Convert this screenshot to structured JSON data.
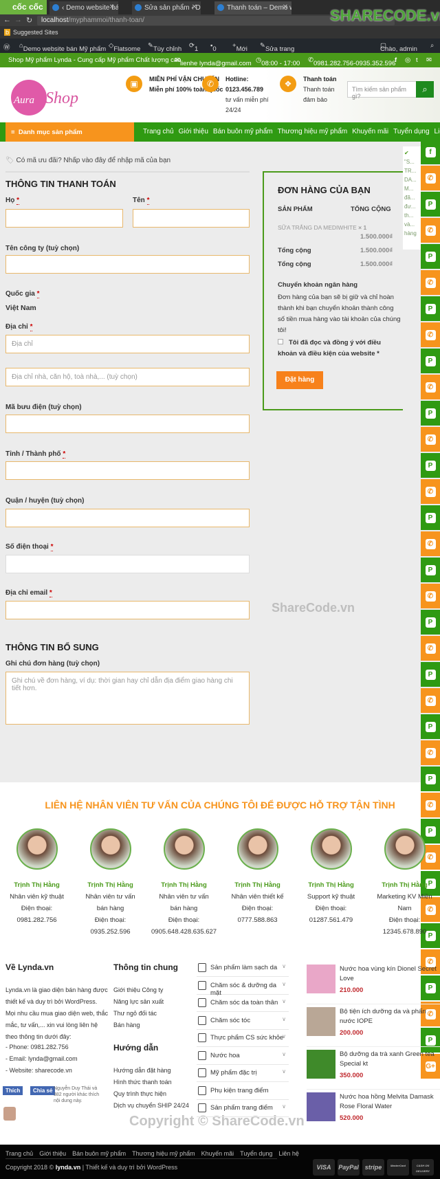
{
  "browser": {
    "brand": "cốc cốc",
    "tabs": [
      "‹ Demo website bán Mỹ p",
      "Sửa sản phẩm ‹ Demo we",
      "Thanh toán – Demo websi"
    ],
    "url_host": "localhost",
    "url_path": "/myphammoi/thanh-toan/",
    "bookmark": "Suggested Sites"
  },
  "wpbar": {
    "site": "Demo website bán Mỹ phẩm",
    "theme": "Flatsome",
    "customize": "Tùy chỉnh",
    "updates": "1",
    "comments": "0",
    "new": "Mới",
    "edit": "Sửa trang",
    "greeting": "Chào, admin"
  },
  "topbar": {
    "tagline": "Shop Mỹ phẩm Lynda - Cung cấp Mỹ phẩm Chất lượng cao",
    "email": "lienhe lynda@gmail.com",
    "hours": "08:00 - 17:00",
    "phone": "0981.282.756-0935.352.596"
  },
  "header": {
    "logo": "The Aura Shop",
    "f1_title": "MIỄN PHÍ VẬN CHUYỂN",
    "f1_text": "Miễn phí 100% toàn quốc",
    "f2_title": "Hotline:",
    "f2_phone": "0123.456.789",
    "f2_text": "tư vấn miễn phí 24/24",
    "f3_title": "Thanh toán",
    "f3_text": "Thanh toán đảm bảo",
    "search_placeholder": "Tìm kiếm sản phẩm gì?"
  },
  "nav": {
    "category": "Danh mục sản phẩm",
    "links": [
      "Trang chủ",
      "Giới thiệu",
      "Bán buôn mỹ phẩm",
      "Thương hiệu mỹ phẩm",
      "Khuyến mãi",
      "Tuyển dụng",
      "Liên hệ"
    ]
  },
  "checkout": {
    "coupon": "Có mã ưu đãi? Nhấp vào đây để nhập mã của bạn",
    "billing_title": "THÔNG TIN THANH TOÁN",
    "first_name": "Họ",
    "last_name": "Tên",
    "required": "*",
    "company": "Tên công ty (tuỳ chọn)",
    "country": "Quốc gia",
    "country_value": "Việt Nam",
    "address": "Địa chỉ",
    "address_ph": "Địa chỉ",
    "address2_ph": "Địa chỉ nhà, căn hộ, toà nhà,... (tuỳ chọn)",
    "postcode": "Mã bưu điện (tuỳ chọn)",
    "city": "Tỉnh / Thành phố",
    "district": "Quận / huyện (tuỳ chọn)",
    "phone": "Số điện thoại",
    "email": "Địa chỉ email",
    "extra_title": "THÔNG TIN BỔ SUNG",
    "notes": "Ghi chú đơn hàng (tuỳ chọn)",
    "notes_ph": "Ghi chú về đơn hàng, ví dụ: thời gian hay chỉ dẫn địa điểm giao hàng chi tiết hơn."
  },
  "order": {
    "title": "ĐƠN HÀNG CỦA BẠN",
    "col_product": "SẢN PHẨM",
    "col_total": "TỔNG CỘNG",
    "item": "SỮA TRẮNG DA MEDIWHITE",
    "qty": "× 1",
    "item_total": "1.500.000₫",
    "subtotal_label": "Tổng cộng",
    "subtotal": "1.500.000₫",
    "total_label": "Tổng cộng",
    "total": "1.500.000₫",
    "payment_title": "Chuyển khoản ngân hàng",
    "payment_desc": "Đơn hàng của bạn sẽ bị giữ và chỉ hoàn thành khi bạn chuyển khoản thành công số tiền mua hàng vào tài khoản của chúng tôi!",
    "terms": "Tôi đã đọc và đồng ý với điều khoản và điều kiện của website *",
    "place_order": "Đặt hàng"
  },
  "popup": {
    "text": "\"S... TR... DA... M... đã... đư... th... và... hàng"
  },
  "floating_buttons": {
    "first": "facebook",
    "pattern": [
      "phone",
      "pinterest"
    ],
    "last": "google-plus",
    "colors": {
      "phone": "#f7941d",
      "pinterest": "#2f9a12",
      "facebook": "#2f9a12",
      "google-plus": "#f7941d"
    }
  },
  "watermarks": {
    "logo": "SHARECODE.vn",
    "mid": "ShareCode.vn",
    "bottom": "Copyright © ShareCode.vn"
  },
  "staff": {
    "title": "LIÊN HỆ NHÂN VIÊN TƯ VẤN CỦA CHÚNG TÔI ĐỂ ĐƯỢC HỖ TRỢ TẬN TÌNH",
    "members": [
      {
        "name": "Trịnh Thị Hằng",
        "role": "Nhân viên kỹ thuật",
        "phone": "Điện thoại: 0981.282.756"
      },
      {
        "name": "Trịnh Thị Hằng",
        "role": "Nhân viên tư vấn bán hàng",
        "phone": "Điện thoại: 0935.252.596"
      },
      {
        "name": "Trịnh Thị Hằng",
        "role": "Nhân viên tư vấn bán hàng",
        "phone": "Điện thoại: 0905.648.428.635.627"
      },
      {
        "name": "Trịnh Thị Hằng",
        "role": "Nhân viên thiết kế",
        "phone": "Điện thoại: 0777.588.863"
      },
      {
        "name": "Trịnh Thị Hằng",
        "role": "Support kỹ thuật",
        "phone": "Điện thoại: 01287.561.479"
      },
      {
        "name": "Trịnh Thị Hằng",
        "role": "Marketing KV Miền Nam",
        "phone": "Điện thoại: 12345.678.890"
      }
    ]
  },
  "footer": {
    "about_title": "Về Lynda.vn",
    "about_text": "Lynda.vn là giao diện bán hàng được thiết kế và duy trì bởi WordPress. Mọi nhu cầu mua giao diện web, thắc mắc, tư vấn,... xin vui lòng liên hệ theo thông tin dưới đây:",
    "phone": "- Phone: 0981.282.756",
    "email": "- Email: lynda@gmail.com",
    "website": "- Website: sharecode.vn",
    "fb_like": "Thích",
    "fb_share": "Chia sẻ",
    "fb_text": "Nguyễn Duy Thái và 382 người khác thích nội dung này.",
    "info_title": "Thông tin chung",
    "info_links": [
      "Giới thiệu Công ty",
      "Năng lực sản xuất",
      "Thư ngỏ đối tác",
      "Bán hàng"
    ],
    "guide_title": "Hướng dẫn",
    "guide_links": [
      "Hướng dẫn đặt hàng",
      "Hình thức thanh toán",
      "Quy trình thực hiện",
      "Dịch vụ chuyển SHIP 24/24"
    ],
    "categories": [
      "Sản phẩm làm sạch da",
      "Chăm sóc & dưỡng da mặt",
      "Chăm sóc da toàn thân",
      "Chăm sóc tóc",
      "Thực phẩm CS sức khỏe",
      "Nước hoa",
      "Mỹ phẩm đặc trị",
      "Phụ kiện trang điểm",
      "Sản phẩm trang điểm"
    ],
    "products": [
      {
        "name": "Nước hoa vùng kín Dionel Secret Love",
        "price": "210.000",
        "color": "#e9a7c8"
      },
      {
        "name": "Bộ tiện ích dưỡng da và phấn nước IOPE",
        "price": "200.000",
        "color": "#b9a796"
      },
      {
        "name": "Bộ dưỡng da trà xanh Green tea Special kt",
        "price": "350.000",
        "color": "#3f8a2a"
      },
      {
        "name": "Nước hoa hồng Melvita Damask Rose Floral Water",
        "price": "520.000",
        "color": "#6a5fa8"
      }
    ],
    "bottom_links": [
      "Trang chủ",
      "Giới thiệu",
      "Bán buôn mỹ phẩm",
      "Thương hiệu mỹ phẩm",
      "Khuyến mãi",
      "Tuyển dụng",
      "Liên hệ"
    ],
    "copyright_pre": "Copyright 2018 ©",
    "copyright_site": "lynda.vn",
    "copyright_post": "| Thiết kế và duy trì bởi WordPress",
    "payments": [
      "VISA",
      "PayPal",
      "stripe",
      "MasterCard",
      "CASH ON DELIVERY"
    ]
  }
}
